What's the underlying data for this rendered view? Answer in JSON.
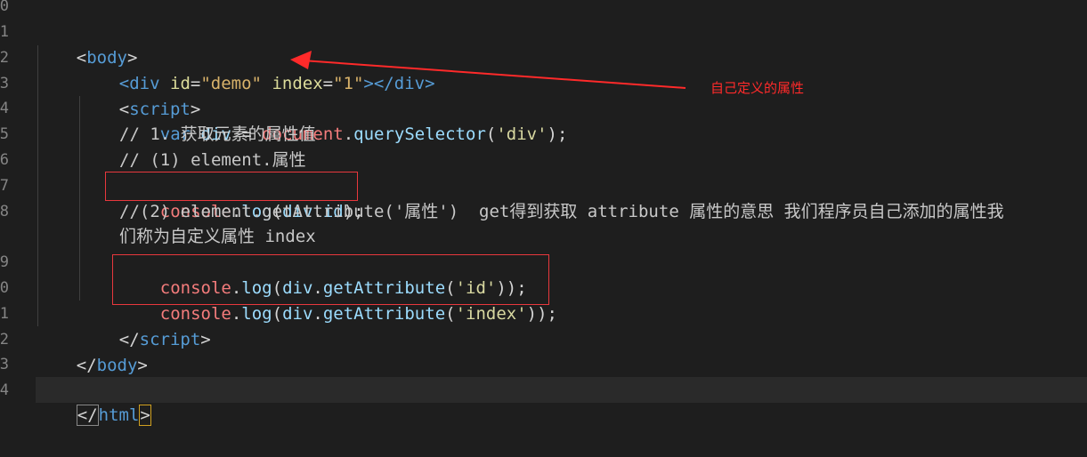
{
  "editor": {
    "line_numbers": [
      "0",
      "1",
      "2",
      "3",
      "4",
      "5",
      "6",
      "7",
      "8",
      "",
      "9",
      "0",
      "1",
      "2",
      "3",
      "4"
    ],
    "lines": {
      "l1": {
        "open": "<",
        "tag": "body",
        "close": ">"
      },
      "l2": {
        "open": "<",
        "tag": "div",
        "attr1": "id",
        "eq1": "=",
        "val1": "\"demo\"",
        "attr2": "index",
        "eq2": "=",
        "val2": "\"1\"",
        "mid": "></",
        "tag2": "div",
        "close": ">"
      },
      "l3": {
        "open": "<",
        "tag": "script",
        "close": ">"
      },
      "l4": {
        "kw": "var",
        "var": "div",
        "op": " = ",
        "doc": "document",
        "dot": ".",
        "fn": "querySelector",
        "p1": "(",
        "str": "'div'",
        "p2": ");"
      },
      "l5": {
        "comment": "// 1. 获取元素的属性值"
      },
      "l6": {
        "comment": "// (1) element.属性"
      },
      "l7": {
        "obj": "console",
        "dot": ".",
        "fn": "log",
        "p1": "(",
        "arg": "div",
        "dot2": ".",
        "prop": "id",
        "p2": ");"
      },
      "l8": {
        "comment": "//(2) element.getAttribute('属性')  get得到获取 attribute 属性的意思 我们程序员自己添加的属性我"
      },
      "l8b": {
        "comment": "们称为自定义属性 index"
      },
      "l9": {
        "obj": "console",
        "dot": ".",
        "fn": "log",
        "p1": "(",
        "arg": "div",
        "dot2": ".",
        "fn2": "getAttribute",
        "p3": "(",
        "str": "'id'",
        "p2": "));"
      },
      "l10": {
        "obj": "console",
        "dot": ".",
        "fn": "log",
        "p1": "(",
        "arg": "div",
        "dot2": ".",
        "fn2": "getAttribute",
        "p3": "(",
        "str": "'index'",
        "p2": "));"
      },
      "l11": {
        "open": "</",
        "tag": "script",
        "close": ">"
      },
      "l12": {
        "open": "</",
        "tag": "body",
        "close": ">"
      },
      "l14": {
        "open": "</",
        "tag": "html",
        "close": ">"
      }
    }
  },
  "annotation": {
    "text": "自己定义的属性",
    "color": "#ff2a2a"
  },
  "colors": {
    "highlight_box": "#e8383d",
    "background": "#1e1e1e"
  }
}
